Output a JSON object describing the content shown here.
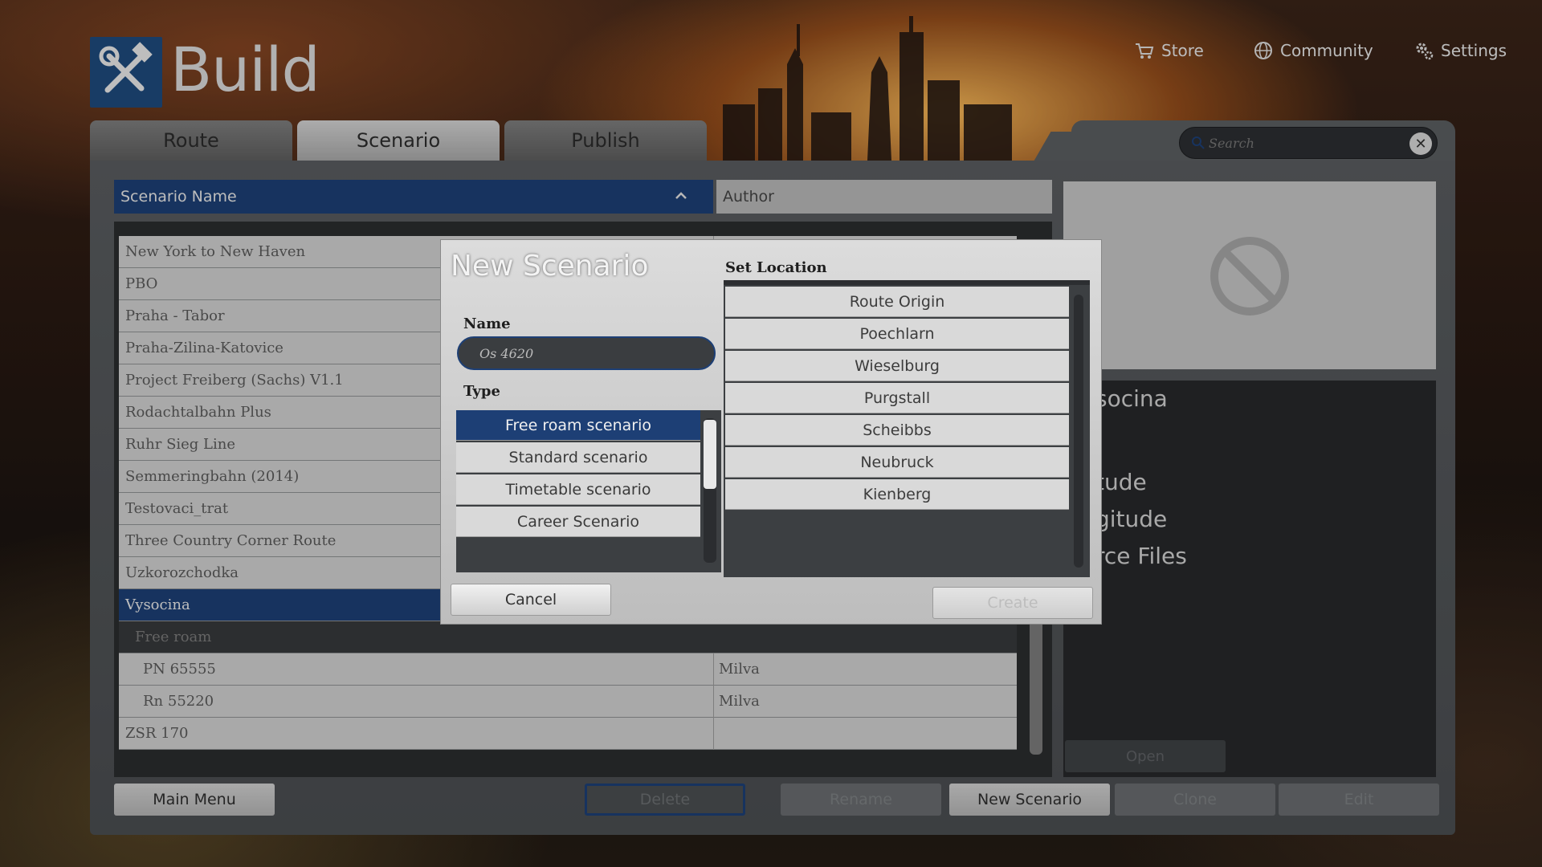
{
  "app": {
    "title": "Build"
  },
  "topnav": {
    "store": "Store",
    "community": "Community",
    "settings": "Settings"
  },
  "tabs": [
    {
      "label": "Route"
    },
    {
      "label": "Scenario"
    },
    {
      "label": "Publish"
    }
  ],
  "search": {
    "placeholder": "Search"
  },
  "columns": {
    "name": "Scenario Name",
    "author": "Author"
  },
  "rows": [
    {
      "name": "New York to New Haven",
      "author": ""
    },
    {
      "name": "PBO",
      "author": ""
    },
    {
      "name": "Praha - Tabor",
      "author": ""
    },
    {
      "name": "Praha-Zilina-Katovice",
      "author": ""
    },
    {
      "name": "Project Freiberg (Sachs) V1.1",
      "author": ""
    },
    {
      "name": "Rodachtalbahn Plus",
      "author": ""
    },
    {
      "name": "Ruhr Sieg Line",
      "author": ""
    },
    {
      "name": "Semmeringbahn (2014)",
      "author": ""
    },
    {
      "name": "Testovaci_trat",
      "author": ""
    },
    {
      "name": "Three Country Corner Route",
      "author": ""
    },
    {
      "name": "Uzkorozchodka",
      "author": ""
    },
    {
      "name": "Vysocina",
      "author": ""
    },
    {
      "name": "Free roam",
      "author": ""
    },
    {
      "name": "PN 65555",
      "author": "Milva"
    },
    {
      "name": "Rn 55220",
      "author": "Milva"
    },
    {
      "name": "ZSR 170",
      "author": ""
    }
  ],
  "details": {
    "route_partial": "socina",
    "latitude_partial": "tude",
    "longitude_partial": "gitude",
    "source_partial": "rce Files"
  },
  "buttons": {
    "open": "Open",
    "main_menu": "Main Menu",
    "delete": "Delete",
    "rename": "Rename",
    "new_scenario": "New Scenario",
    "clone": "Clone",
    "edit": "Edit"
  },
  "dialog": {
    "title": "New Scenario",
    "name_label": "Name",
    "name_value": "Os 4620",
    "type_label": "Type",
    "types": [
      {
        "label": "Free roam scenario"
      },
      {
        "label": "Standard scenario"
      },
      {
        "label": "Timetable scenario"
      },
      {
        "label": "Career Scenario"
      }
    ],
    "location_label": "Set Location",
    "locations": [
      {
        "label": "Route Origin"
      },
      {
        "label": "Poechlarn"
      },
      {
        "label": "Wieselburg"
      },
      {
        "label": "Purgstall"
      },
      {
        "label": "Scheibbs"
      },
      {
        "label": "Neubruck"
      },
      {
        "label": "Kienberg"
      }
    ],
    "cancel": "Cancel",
    "create": "Create"
  },
  "colors": {
    "accent": "#1d3f75",
    "panel": "#585b5e",
    "row": "#cfcfcf"
  }
}
